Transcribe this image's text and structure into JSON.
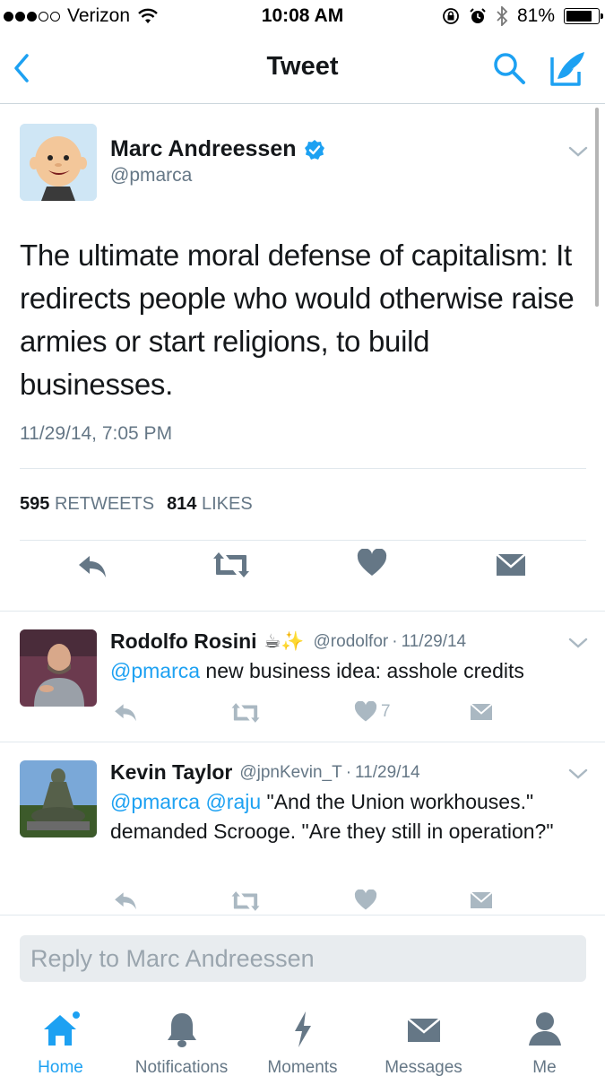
{
  "status_bar": {
    "carrier": "Verizon",
    "time": "10:08 AM",
    "battery": "81%",
    "battery_level": 0.81,
    "signal_bars": 3,
    "signal_total": 5
  },
  "nav": {
    "title": "Tweet",
    "back_icon": "chevron-left-icon",
    "search_icon": "search-icon",
    "compose_icon": "compose-icon"
  },
  "tweet": {
    "author_name": "Marc Andreessen",
    "author_handle": "@pmarca",
    "verified": true,
    "text": "The ultimate moral defense of capitalism: It redirects people who would otherwise raise armies or start religions, to build businesses.",
    "timestamp": "11/29/14, 7:05 PM",
    "retweets_count": "595",
    "retweets_label": "RETWEETS",
    "likes_count": "814",
    "likes_label": "LIKES"
  },
  "replies": [
    {
      "name": "Rodolfo Rosini",
      "emoji": "☕✨",
      "handle": "@rodolfor",
      "separator": "·",
      "date": "11/29/14",
      "mention": "@pmarca",
      "text": " new business idea: asshole credits",
      "likes": "7"
    },
    {
      "name": "Kevin Taylor",
      "handle": "@jpnKevin_T",
      "separator": "·",
      "date": "11/29/14",
      "mention1": "@pmarca",
      "mention2": "@raju",
      "text": " \"And the Union workhouses.\" demanded Scrooge. \"Are they still in operation?\""
    }
  ],
  "reply_box": {
    "placeholder": "Reply to Marc Andreessen"
  },
  "tabs": [
    {
      "label": "Home",
      "icon": "home-icon",
      "active": true
    },
    {
      "label": "Notifications",
      "icon": "bell-icon",
      "active": false
    },
    {
      "label": "Moments",
      "icon": "lightning-icon",
      "active": false
    },
    {
      "label": "Messages",
      "icon": "envelope-icon",
      "active": false
    },
    {
      "label": "Me",
      "icon": "person-icon",
      "active": false
    }
  ],
  "colors": {
    "accent": "#1da1f2",
    "text_primary": "#14171a",
    "text_secondary": "#657786",
    "icon_gray": "#aab8c2",
    "divider": "#e1e8ed"
  }
}
